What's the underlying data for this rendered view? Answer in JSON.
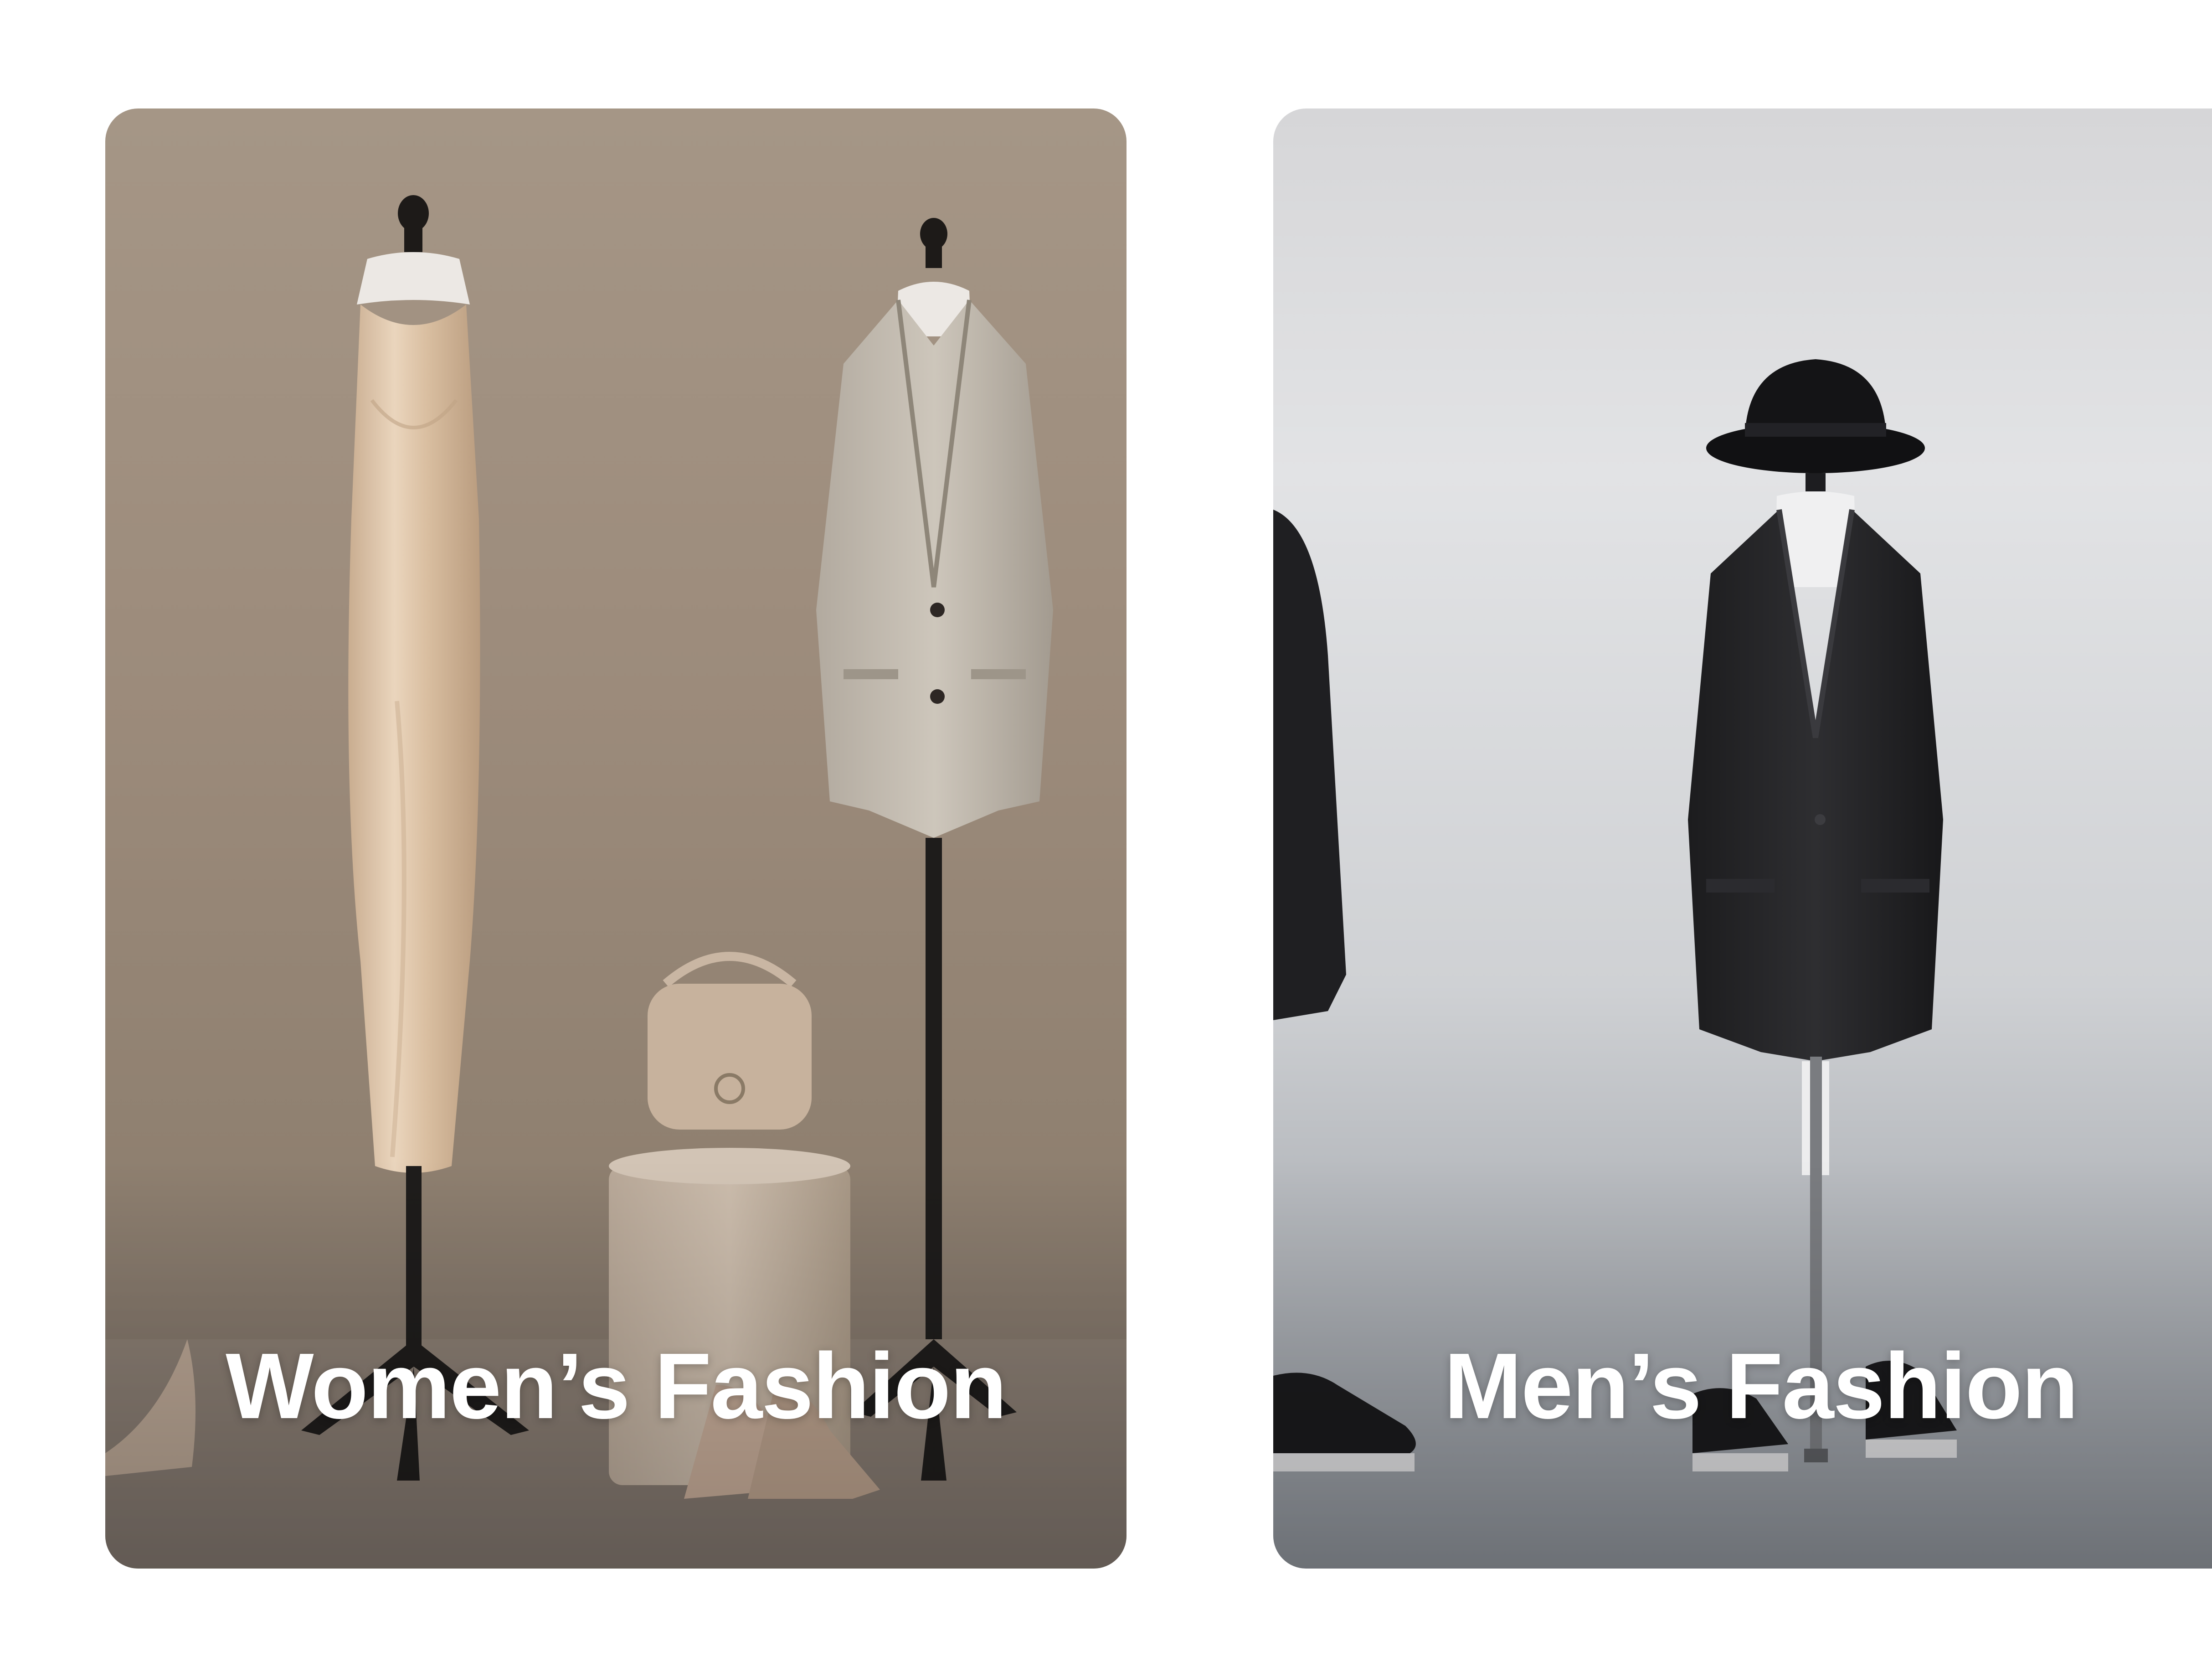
{
  "categories": [
    {
      "title": "Women’s Fashion",
      "image": "womens-fashion-mannequins-photo"
    },
    {
      "title": "Men’s Fashion",
      "image": "mens-fashion-mannequin-photo"
    }
  ]
}
